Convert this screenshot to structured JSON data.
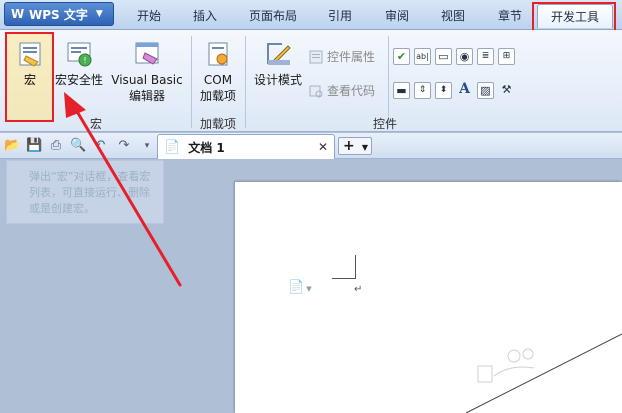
{
  "app": {
    "name": "WPS 文字"
  },
  "tabs": [
    {
      "label": "开始"
    },
    {
      "label": "插入"
    },
    {
      "label": "页面布局"
    },
    {
      "label": "引用"
    },
    {
      "label": "审阅"
    },
    {
      "label": "视图"
    },
    {
      "label": "章节"
    },
    {
      "label": "开发工具",
      "active": true
    }
  ],
  "ribbon": {
    "macro": {
      "label": "宏"
    },
    "macro_security": {
      "label": "宏安全性"
    },
    "vb_editor": {
      "line1": "Visual Basic",
      "line2": "编辑器"
    },
    "com_addins": {
      "line1": "COM",
      "line2": "加载项"
    },
    "design_mode": {
      "label": "设计模式"
    },
    "control_properties": {
      "label": "控件属性"
    },
    "view_code": {
      "label": "查看代码"
    },
    "groups": {
      "macro": "宏",
      "addins": "加载项",
      "controls": "控件"
    }
  },
  "tooltip": {
    "text": "弹出“宏”对话框，查看宏列表，可直接运行、删除或是创建宏。"
  },
  "document": {
    "tab_name": "文档 1",
    "paragraph_mark": "↵"
  },
  "colors": {
    "highlight": "#e5202b",
    "accent": "#2e63b5"
  }
}
